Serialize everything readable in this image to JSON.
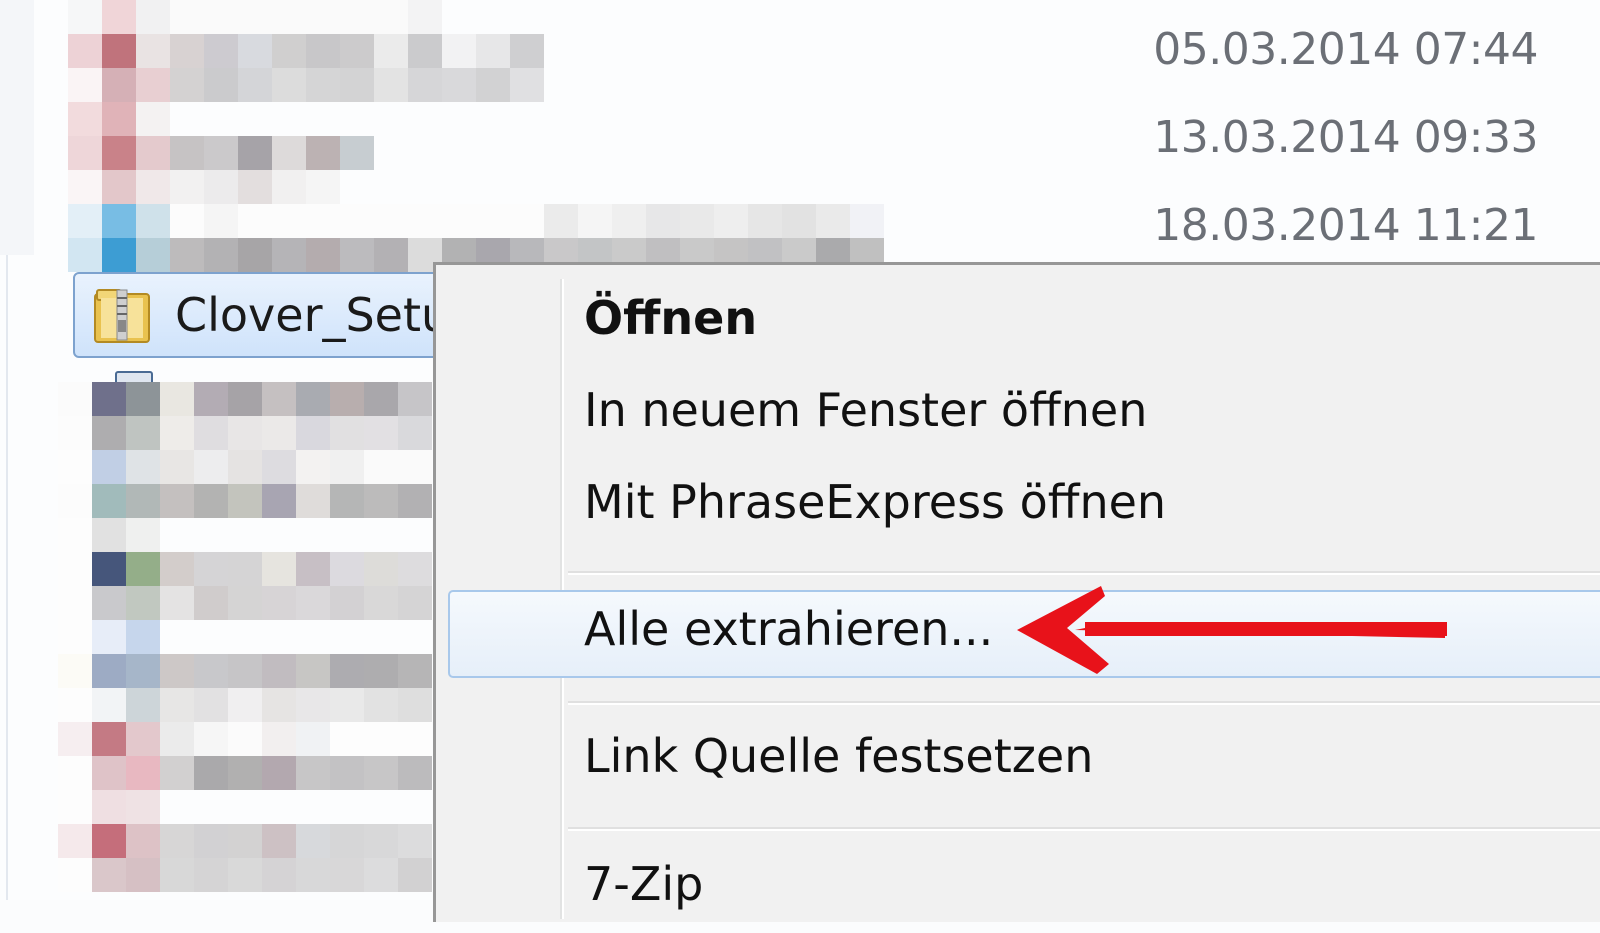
{
  "file_list": {
    "dates": [
      "05.03.2014 07:44",
      "13.03.2014 09:33",
      "18.03.2014 11:21"
    ],
    "selected_item": {
      "name": "Clover_Setu",
      "icon": "zip-folder-icon"
    }
  },
  "context_menu": {
    "items": [
      {
        "label": "Öffnen",
        "bold": true
      },
      {
        "label": "In neuem Fenster öffnen"
      },
      {
        "label": "Mit PhraseExpress öffnen"
      },
      {
        "label": "Alle extrahieren...",
        "highlighted": true
      },
      {
        "label": "Link Quelle festsetzen"
      },
      {
        "label": "7-Zip"
      }
    ]
  },
  "annotation": {
    "arrow_color": "#e8121a",
    "icon": "red-arrow-icon"
  },
  "colors": {
    "selection_border": "#7da2ce",
    "menu_bg": "#f1f1f1",
    "hover_border": "#a8c8eb"
  }
}
